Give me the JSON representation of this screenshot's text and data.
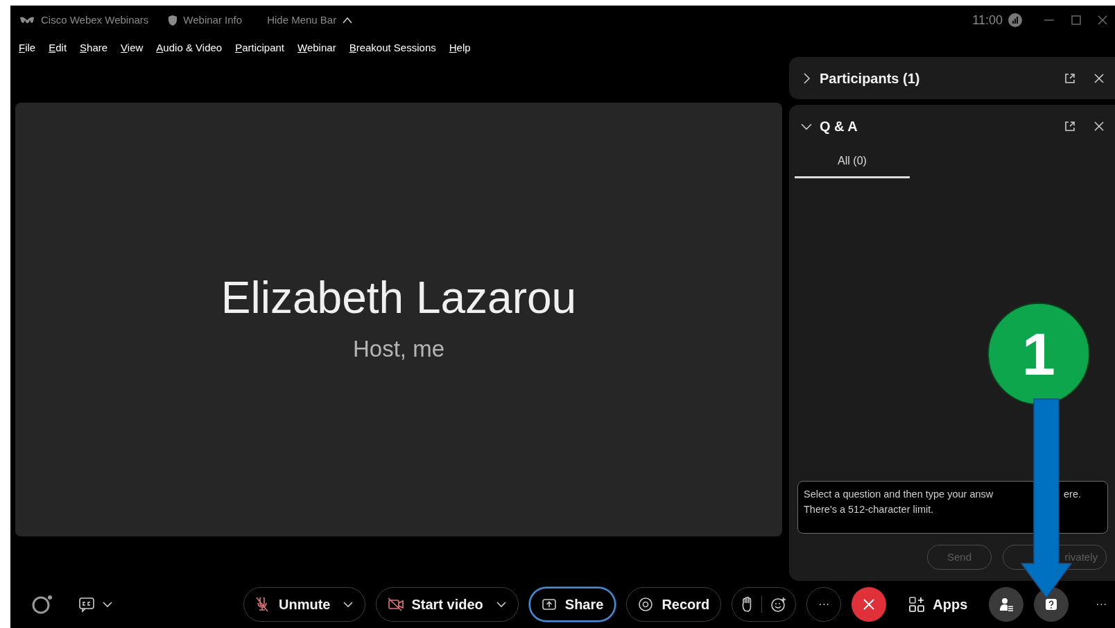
{
  "title_bar": {
    "app": "Cisco Webex Webinars",
    "info": "Webinar Info",
    "hide_menu": "Hide Menu Bar",
    "time": "11:00"
  },
  "menu": [
    {
      "accel": "F",
      "rest": "ile"
    },
    {
      "accel": "E",
      "rest": "dit"
    },
    {
      "accel": "S",
      "rest": "hare"
    },
    {
      "accel": "V",
      "rest": "iew"
    },
    {
      "accel": "A",
      "rest": "udio & Video"
    },
    {
      "accel": "P",
      "rest": "articipant"
    },
    {
      "accel": "W",
      "rest": "ebinar"
    },
    {
      "accel": "B",
      "rest": "reakout Sessions"
    },
    {
      "accel": "H",
      "rest": "elp"
    }
  ],
  "stage": {
    "name": "Elizabeth Lazarou",
    "role": "Host, me"
  },
  "panels": [
    {
      "title": "Participants (1)",
      "expanded": false
    },
    {
      "title": "Q & A",
      "expanded": true,
      "tabs": [
        {
          "label": "All (0)",
          "selected": true
        }
      ],
      "answer": {
        "placeholder": [
          "Select a question and then type your answ",
          "ere.",
          "There's a 512-character limit."
        ]
      },
      "buttons": [
        {
          "label": "Send",
          "disabled": true
        },
        {
          "label": "rivately",
          "disabled": true
        }
      ]
    }
  ],
  "toolbar": [
    {
      "kind": "pill",
      "label": "Unmute",
      "dropdown": true,
      "focused": false
    },
    {
      "kind": "pill",
      "label": "Start video",
      "dropdown": true,
      "focused": false
    },
    {
      "kind": "pill",
      "label": "Share",
      "dropdown": false,
      "focused": true
    },
    {
      "kind": "pill",
      "label": "Record",
      "dropdown": false,
      "focused": false
    },
    {
      "kind": "group"
    },
    {
      "kind": "round",
      "label": "···",
      "active": false
    },
    {
      "kind": "end"
    },
    {
      "kind": "plain",
      "label": "Apps"
    },
    {
      "kind": "round",
      "active": true
    },
    {
      "kind": "round",
      "active": true
    },
    {
      "kind": "text",
      "label": "···"
    }
  ],
  "callout": {
    "number": "1"
  }
}
